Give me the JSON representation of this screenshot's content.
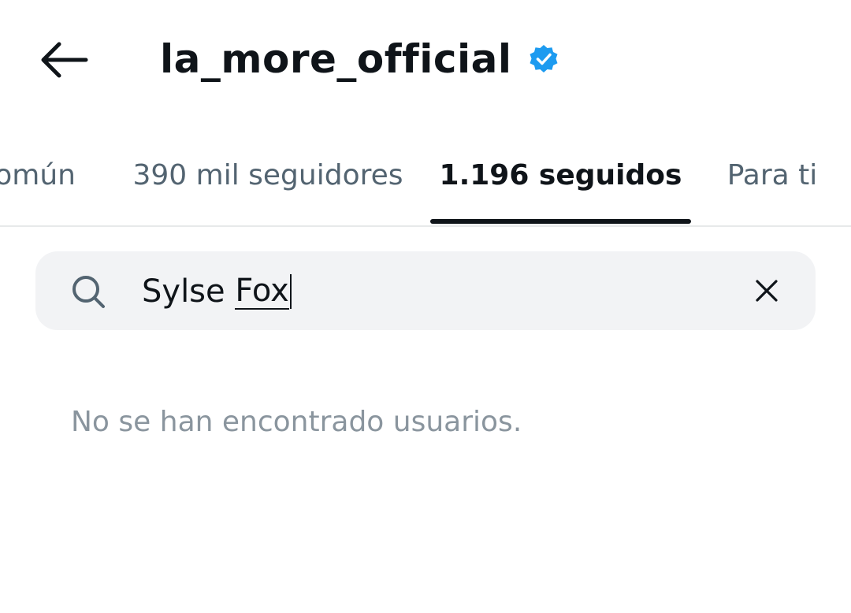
{
  "header": {
    "back_icon": "arrow-left-icon",
    "title": "la_more_official",
    "verified_icon": "verified-badge-icon",
    "verified_color": "#1d9bf0"
  },
  "tabs": [
    {
      "label": "omún",
      "active": false
    },
    {
      "label": "390 mil seguidores",
      "active": false
    },
    {
      "label": "1.196 seguidos",
      "active": true
    },
    {
      "label": "Para ti",
      "active": false
    }
  ],
  "search": {
    "icon": "search-icon",
    "value_prefix": "Sylse ",
    "value_last_word": "Fox",
    "clear_icon": "close-icon"
  },
  "results": {
    "empty_message": "No se han encontrado usuarios."
  },
  "colors": {
    "text_primary": "#0f1419",
    "text_secondary": "#536471",
    "muted": "#8a959e",
    "search_bg": "#f2f3f5",
    "divider": "#e7e9ea"
  }
}
